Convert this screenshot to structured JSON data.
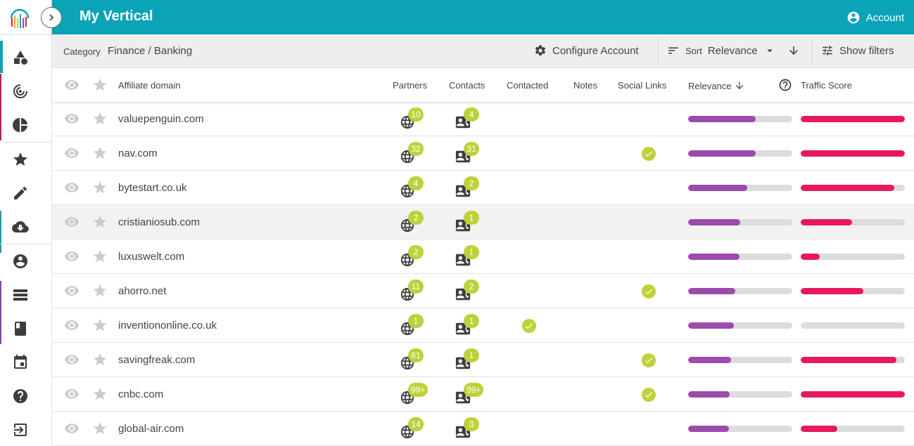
{
  "colors": {
    "accent": "#0aa3b8",
    "badge": "#bed13a",
    "relevance": "#9c4aae",
    "traffic": "#e8185e"
  },
  "header": {
    "title": "My Vertical",
    "account_label": "Account"
  },
  "toolbar": {
    "category_label": "Category",
    "category_value": "Finance / Banking",
    "configure_label": "Configure Account",
    "sort_label": "Sort",
    "sort_value": "Relevance",
    "filters_label": "Show filters"
  },
  "sidebar": {
    "icons": [
      "shapes-icon",
      "target-icon",
      "pie-chart-icon",
      "star-icon",
      "edit-icon",
      "cloud-download-icon",
      "user-icon",
      "list-icon",
      "book-icon",
      "calendar-icon",
      "help-icon",
      "logout-icon"
    ]
  },
  "table": {
    "columns": {
      "domain": "Affiliate domain",
      "partners": "Partners",
      "contacts": "Contacts",
      "contacted": "Contacted",
      "notes": "Notes",
      "social": "Social Links",
      "relevance": "Relevance",
      "traffic": "Traffic Score"
    },
    "rows": [
      {
        "domain": "valuepenguin.com",
        "partners": "10",
        "contacts": "4",
        "contacted": false,
        "social": false,
        "relevance": 0.65,
        "traffic": 1.0
      },
      {
        "domain": "nav.com",
        "partners": "32",
        "contacts": "31",
        "contacted": false,
        "social": true,
        "relevance": 0.65,
        "traffic": 1.0
      },
      {
        "domain": "bytestart.co.uk",
        "partners": "4",
        "contacts": "2",
        "contacted": false,
        "social": false,
        "relevance": 0.57,
        "traffic": 0.9
      },
      {
        "domain": "cristianiosub.com",
        "partners": "2",
        "contacts": "1",
        "contacted": false,
        "social": false,
        "relevance": 0.5,
        "traffic": 0.49
      },
      {
        "domain": "luxuswelt.com",
        "partners": "2",
        "contacts": "1",
        "contacted": false,
        "social": false,
        "relevance": 0.49,
        "traffic": 0.18
      },
      {
        "domain": "ahorro.net",
        "partners": "11",
        "contacts": "2",
        "contacted": false,
        "social": true,
        "relevance": 0.45,
        "traffic": 0.6
      },
      {
        "domain": "inventiononline.co.uk",
        "partners": "1",
        "contacts": "1",
        "contacted": true,
        "social": false,
        "relevance": 0.44,
        "traffic": 0.0
      },
      {
        "domain": "savingfreak.com",
        "partners": "61",
        "contacts": "1",
        "contacted": false,
        "social": true,
        "relevance": 0.41,
        "traffic": 0.92
      },
      {
        "domain": "cnbc.com",
        "partners": "99+",
        "contacts": "99+",
        "contacted": false,
        "social": true,
        "relevance": 0.4,
        "traffic": 1.0
      },
      {
        "domain": "global-air.com",
        "partners": "14",
        "contacts": "3",
        "contacted": false,
        "social": false,
        "relevance": 0.39,
        "traffic": 0.35
      }
    ]
  }
}
